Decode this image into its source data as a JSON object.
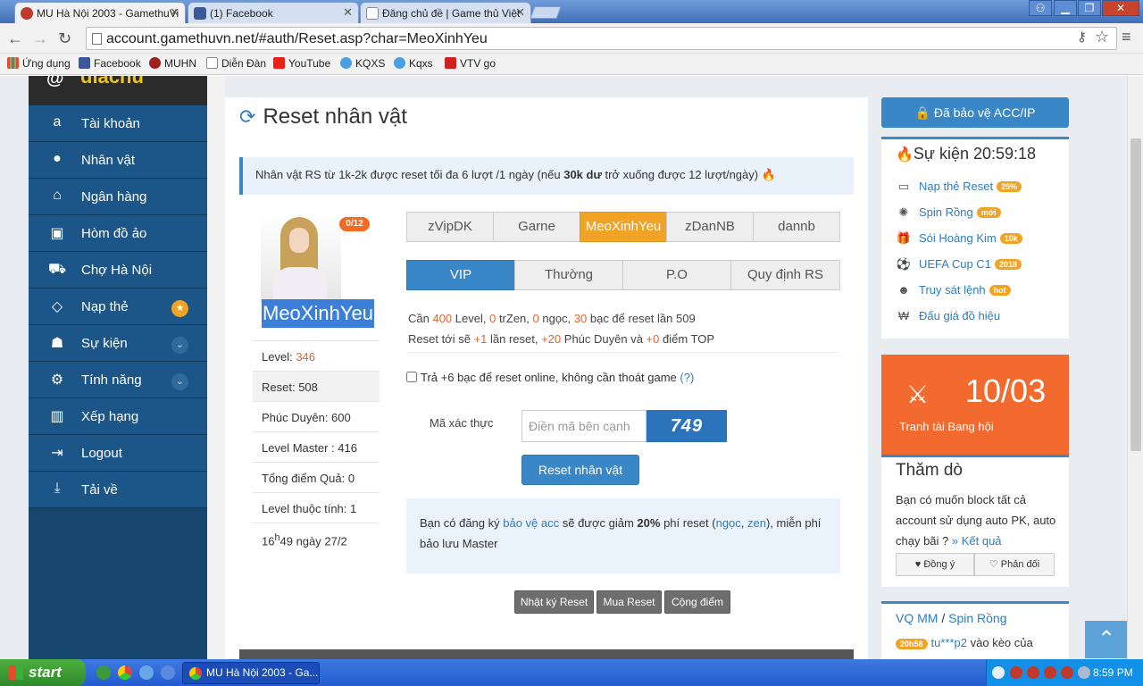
{
  "browser": {
    "tabs": [
      {
        "title": "MU Hà Nội 2003 - GamethuVi",
        "icon_color": "#c0392b",
        "active": true
      },
      {
        "title": "(1) Facebook",
        "icon_color": "#3b5998",
        "active": false
      },
      {
        "title": "Đăng chủ đề | Game thủ Việt",
        "icon_color": "#ffffff",
        "active": false
      }
    ],
    "url": "account.gamethuvn.net/#auth/Reset.asp?char=MeoXinhYeu",
    "bookmarks": [
      {
        "label": "Ứng dụng",
        "icon": "apps-icon",
        "color": "#e94a2a"
      },
      {
        "label": "Facebook",
        "icon": "facebook-icon",
        "color": "#3b5998"
      },
      {
        "label": "MUHN",
        "icon": "muhn-icon",
        "color": "#a02020"
      },
      {
        "label": "Diễn Đàn",
        "icon": "page-icon",
        "color": "#ffffff"
      },
      {
        "label": "YouTube",
        "icon": "youtube-icon",
        "color": "#e62117"
      },
      {
        "label": "KQXS",
        "icon": "kqxs-icon",
        "color": "#4aa0e0"
      },
      {
        "label": "Kqxs",
        "icon": "kqxs-icon",
        "color": "#4aa0e0"
      },
      {
        "label": "VTV go",
        "icon": "vtv-icon",
        "color": "#d02020"
      }
    ]
  },
  "sidebar": {
    "brand": "diachu",
    "items": [
      {
        "label": "Tài khoản",
        "icon": "amazon-icon",
        "glyph": "a"
      },
      {
        "label": "Nhân vật",
        "icon": "user-icon",
        "glyph": "●"
      },
      {
        "label": "Ngân hàng",
        "icon": "bank-icon",
        "glyph": "⌂"
      },
      {
        "label": "Hòm đồ ảo",
        "icon": "briefcase-icon",
        "glyph": "▣"
      },
      {
        "label": "Chợ Hà Nội",
        "icon": "cart-icon",
        "glyph": "⛟"
      },
      {
        "label": "Nạp thẻ",
        "icon": "diamond-icon",
        "glyph": "◇",
        "badge": "★"
      },
      {
        "label": "Sự kiện",
        "icon": "android-icon",
        "glyph": "☗",
        "chevron": "⌄"
      },
      {
        "label": "Tính năng",
        "icon": "gears-icon",
        "glyph": "⚙",
        "chevron": "⌄"
      },
      {
        "label": "Xếp hạng",
        "icon": "bar-chart-icon",
        "glyph": "▥"
      },
      {
        "label": "Logout",
        "icon": "logout-icon",
        "glyph": "⇥"
      },
      {
        "label": "Tải về",
        "icon": "download-icon",
        "glyph": "⤓"
      }
    ]
  },
  "main": {
    "title": "Reset nhân vật",
    "notice": {
      "before": "Nhân vật RS từ 1k-2k được reset tối đa 6 lượt /1 ngày (nếu ",
      "bold": "30k dư",
      "after": " trở xuống được 12 lượt/ngày)"
    },
    "reset_badge": "0/12",
    "character_name": "MeoXinhYeu",
    "stats": [
      {
        "label": "Level: ",
        "value": "346"
      },
      {
        "label": "Reset: ",
        "value": "508"
      },
      {
        "label": "Phúc Duyên: ",
        "value": "600"
      },
      {
        "label": "Level Master : ",
        "value": "416"
      },
      {
        "label": "Tổng điểm Quả: ",
        "value": "0"
      },
      {
        "label": "Level thuộc tính: ",
        "value": "1"
      }
    ],
    "time_stamp": {
      "hour": "16",
      "sup": "h",
      "rest": "49 ngày 27/2"
    },
    "char_tabs": [
      "zVipDK",
      "Garne",
      "MeoXinhYeu",
      "zDanNB",
      "dannb"
    ],
    "active_char_tab": "MeoXinhYeu",
    "mode_tabs": [
      "VIP",
      "Thường",
      "P.O",
      "Quy định RS"
    ],
    "active_mode_tab": "VIP",
    "requirement": {
      "p1": "Cần ",
      "level": "400",
      "p2": " Level, ",
      "zen": "0",
      "p3": " trZen, ",
      "ngoc": "0",
      "p4": " ngọc, ",
      "bac": "30",
      "p5": " bạc để reset lần 509"
    },
    "reward": {
      "p1": "Reset tới sẽ ",
      "reset": "+1",
      "p2": " lần reset, ",
      "phuc": "+20",
      "p3": " Phúc Duyên và ",
      "top": "+0",
      "p4": " điểm TOP"
    },
    "online_checkbox": {
      "label": "Trả +6 bạc để reset online, không cần thoát game ",
      "help": "(?)",
      "checked": false
    },
    "captcha": {
      "label": "Mã xác thực",
      "placeholder": "Điền mã bên cạnh",
      "code": "749"
    },
    "submit_label": "Reset nhân vật",
    "promo": {
      "p1": "Bạn có đăng ký ",
      "link": "bảo vệ acc",
      "p2": " sẽ được giảm ",
      "pct": "20%",
      "p3": " phí reset (",
      "ngoc": "ngọc",
      "comma": ", ",
      "zen": "zen",
      "p4": "), miễn phí bảo lưu Master"
    },
    "footer_buttons": [
      "Nhật ký Reset",
      "Mua Reset",
      "Cộng điểm"
    ]
  },
  "right": {
    "protect_label": "Đã bảo vệ ACC/IP",
    "event_title": "Sự kiện 20:59:18",
    "events": [
      {
        "label": "Nạp thẻ Reset",
        "icon": "card-icon",
        "glyph": "▭",
        "badge": "25%",
        "badge_color": "#f0a324"
      },
      {
        "label": "Spin Rồng",
        "icon": "spinner-icon",
        "glyph": "✺",
        "badge": "mới",
        "badge_color": "#f0a324"
      },
      {
        "label": "Sói Hoàng Kim",
        "icon": "gift-icon",
        "glyph": "🎁",
        "badge": "10k",
        "badge_color": "#f0a324"
      },
      {
        "label": "UEFA Cup C1",
        "icon": "soccer-ball-icon",
        "glyph": "⚽",
        "badge": "2018",
        "badge_color": "#f0a324"
      },
      {
        "label": "Truy sát lệnh",
        "icon": "github-icon",
        "glyph": "☻",
        "badge": "hot",
        "badge_color": "#f0a324"
      },
      {
        "label": "Đấu giá đồ hiệu",
        "icon": "won-icon",
        "glyph": "₩",
        "badge": "",
        "badge_color": ""
      }
    ],
    "banner": {
      "date": "10/03",
      "text": "Tranh tài Bang hội",
      "color": "#f26a2e"
    },
    "poll": {
      "title": "Thăm dò",
      "question": "Bạn có muốn block tất cả account sử dụng auto PK, auto chạy bãi ? ",
      "result_link": "» Kết quả",
      "agree": "Đồng ý",
      "disagree": "Phản đối"
    },
    "vq": {
      "title_a": "VQ MM",
      "sep": " / ",
      "title_b": "Spin Rồng",
      "time": "20h58",
      "user": "tu***p2",
      "rest": " vào kèo của"
    }
  },
  "taskbar": {
    "start": "start",
    "item": "MU Hà Nội 2003 - Ga...",
    "clock": "8:59 PM"
  }
}
